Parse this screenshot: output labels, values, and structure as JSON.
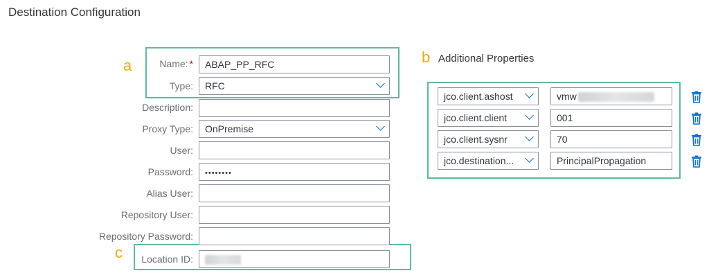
{
  "page": {
    "title": "Destination Configuration"
  },
  "markers": {
    "a": "a",
    "b": "b",
    "c": "c"
  },
  "form": {
    "name": {
      "label": "Name:",
      "required_mark": "*",
      "value": "ABAP_PP_RFC"
    },
    "type": {
      "label": "Type:",
      "value": "RFC"
    },
    "description": {
      "label": "Description:",
      "value": ""
    },
    "proxy_type": {
      "label": "Proxy Type:",
      "value": "OnPremise"
    },
    "user": {
      "label": "User:",
      "value": ""
    },
    "password": {
      "label": "Password:",
      "value": "••••••••"
    },
    "alias_user": {
      "label": "Alias User:",
      "value": ""
    },
    "repository_user": {
      "label": "Repository User:",
      "value": ""
    },
    "repository_password": {
      "label": "Repository Password:",
      "value": ""
    },
    "location_id": {
      "label": "Location ID:",
      "value_redacted": true
    }
  },
  "additional_properties": {
    "title": "Additional Properties",
    "rows": [
      {
        "key": "jco.client.ashost",
        "value": "vmw",
        "value_redacted_suffix": true
      },
      {
        "key": "jco.client.client",
        "value": "001"
      },
      {
        "key": "jco.client.sysnr",
        "value": "70"
      },
      {
        "key": "jco.destination...",
        "value": "PrincipalPropagation"
      }
    ]
  },
  "icons": {
    "delete": "trash-icon",
    "dropdown": "chevron-down-icon"
  },
  "colors": {
    "highlight": "#5dbb9d",
    "marker": "#f0ab00",
    "accent": "#0a6ed1",
    "required": "#bb0000"
  }
}
